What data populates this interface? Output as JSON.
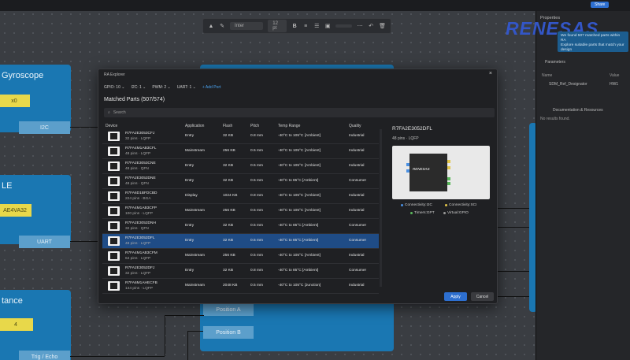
{
  "top_strip": {
    "share_label": "Share"
  },
  "toolbar": {
    "font_name": "Inter",
    "font_size": "12 pt"
  },
  "canvas": {
    "blocks": {
      "gyroscope_title": "Gyroscope",
      "gyro_value": "x0",
      "gyro_pin": "I2C",
      "ble_title": "LE",
      "ble_value": "AE4VA32",
      "ble_pin": "UART",
      "distance_title": "tance",
      "distance_value": "4",
      "distance_pin": "Trig / Echo",
      "position_a": "Position A",
      "position_b": "Position B"
    }
  },
  "right_panel": {
    "properties_title": "Properties",
    "logo_text": "RENESAS",
    "notice_line1": "We found 507 matched parts within RA",
    "notice_line2": "Explore suitable parts that match your design",
    "parameters_title": "Parameters",
    "param_name_header": "Name",
    "param_value_header": "Value",
    "param_row_name": "SDM_Ref_Designator",
    "param_row_value": "HW1",
    "docs_title": "Documentation & Resources",
    "no_results": "No results found."
  },
  "modal": {
    "title": "RA Explorer",
    "close_icon": "close-icon",
    "filters": [
      {
        "label": "GPIO:",
        "value": "10"
      },
      {
        "label": "I2C:",
        "value": "1"
      },
      {
        "label": "PWM:",
        "value": "2"
      },
      {
        "label": "UART:",
        "value": "1"
      }
    ],
    "add_port": "+ Add Port",
    "heading": "Matched Parts (507/574)",
    "search_placeholder": "Search",
    "columns": [
      "Device",
      "Application",
      "Flash",
      "Pitch",
      "Temp Range",
      "Quality"
    ],
    "rows": [
      {
        "device": "R7FA2E3053CFJ",
        "pkg": "32 pins · LQFP",
        "application": "Entry",
        "flash": "32 KB",
        "pitch": "0.8 mm",
        "temp": "-40°C to 105°C [Ambient]",
        "quality": "Industrial"
      },
      {
        "device": "R7FA4M1AB3CFL",
        "pkg": "48 pins · LQFP",
        "application": "Mainstream",
        "flash": "256 KB",
        "pitch": "0.5 mm",
        "temp": "-40°C to 105°C [Ambient]",
        "quality": "Industrial"
      },
      {
        "device": "R7FA2E3053CNE",
        "pkg": "48 pins · QFN",
        "application": "Entry",
        "flash": "32 KB",
        "pitch": "0.5 mm",
        "temp": "-40°C to 105°C [Ambient]",
        "quality": "Industrial"
      },
      {
        "device": "R7FA2E3052DNE",
        "pkg": "48 pins · QFN",
        "application": "Entry",
        "flash": "32 KB",
        "pitch": "0.5 mm",
        "temp": "-40°C to 85°C [Ambient]",
        "quality": "Consumer"
      },
      {
        "device": "R7FA6D1BFDCBD",
        "pkg": "224 pins · BGA",
        "application": "Display",
        "flash": "1024 KB",
        "pitch": "0.8 mm",
        "temp": "-40°C to 105°C [Ambient]",
        "quality": "Industrial"
      },
      {
        "device": "R7FA4M1AB3CFP",
        "pkg": "100 pins · LQFP",
        "application": "Mainstream",
        "flash": "256 KB",
        "pitch": "0.5 mm",
        "temp": "-40°C to 105°C [Ambient]",
        "quality": "Industrial"
      },
      {
        "device": "R7FA2E3052DNH",
        "pkg": "32 pins · QFN",
        "application": "Entry",
        "flash": "32 KB",
        "pitch": "0.5 mm",
        "temp": "-40°C to 85°C [Ambient]",
        "quality": "Consumer"
      },
      {
        "device": "R7FA2E3052DFL",
        "pkg": "48 pins · LQFP",
        "application": "Entry",
        "flash": "32 KB",
        "pitch": "0.5 mm",
        "temp": "-40°C to 85°C [Ambient]",
        "quality": "Consumer"
      },
      {
        "device": "R7FA4M1AB3CFM",
        "pkg": "64 pins · LQFP",
        "application": "Mainstream",
        "flash": "256 KB",
        "pitch": "0.5 mm",
        "temp": "-40°C to 105°C [Ambient]",
        "quality": "Industrial"
      },
      {
        "device": "R7FA2E3052DFJ",
        "pkg": "32 pins · LQFP",
        "application": "Entry",
        "flash": "32 KB",
        "pitch": "0.8 mm",
        "temp": "-40°C to 85°C [Ambient]",
        "quality": "Consumer"
      },
      {
        "device": "R7FA6M1AHECFB",
        "pkg": "144 pins · LQFP",
        "application": "Mainstream",
        "flash": "2048 KB",
        "pitch": "0.5 mm",
        "temp": "-40°C to 105°C [Junction]",
        "quality": "Industrial"
      }
    ],
    "selected_index": 7,
    "detail": {
      "name": "R7FA2E3052DFL",
      "subtitle": "48 pins · LQFP",
      "chip_label": "RENESAS",
      "legend": [
        {
          "label": "Connectivity:I2C",
          "color": "#4a90e2"
        },
        {
          "label": "Connectivity:SCI",
          "color": "#e3c64a"
        },
        {
          "label": "Timers:GPT",
          "color": "#5bb85c"
        },
        {
          "label": "Virtual:GPIO",
          "color": "#999999"
        }
      ]
    },
    "apply_label": "Apply",
    "cancel_label": "Cancel"
  }
}
